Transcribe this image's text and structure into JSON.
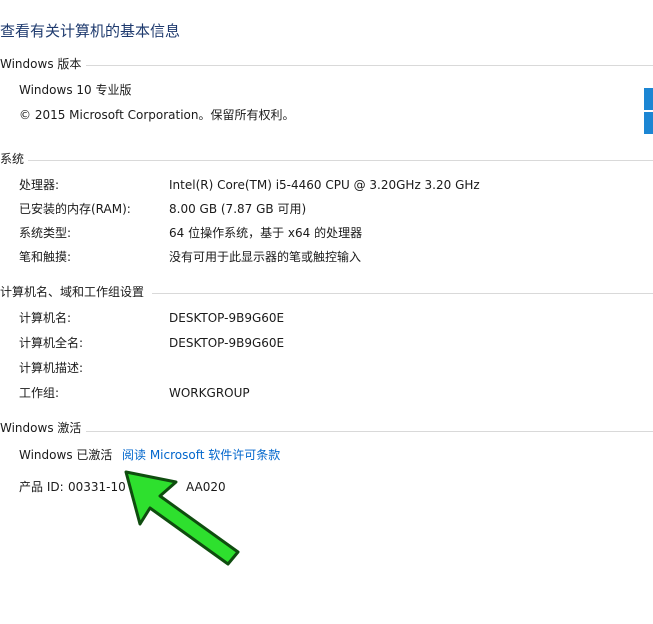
{
  "page": {
    "title": "查看有关计算机的基本信息"
  },
  "edition": {
    "header": "Windows 版本",
    "name": "Windows 10 专业版",
    "copyright": "© 2015 Microsoft Corporation。保留所有权利。"
  },
  "system": {
    "header": "系统",
    "rows": [
      {
        "label": "处理器:",
        "value": "Intel(R) Core(TM) i5-4460  CPU @ 3.20GHz   3.20 GHz"
      },
      {
        "label": "已安装的内存(RAM):",
        "value": "8.00 GB (7.87 GB 可用)"
      },
      {
        "label": "系统类型:",
        "value": "64 位操作系统，基于 x64 的处理器"
      },
      {
        "label": "笔和触摸:",
        "value": "没有可用于此显示器的笔或触控输入"
      }
    ]
  },
  "computer": {
    "header": "计算机名、域和工作组设置",
    "rows": [
      {
        "label": "计算机名:",
        "value": "DESKTOP-9B9G60E"
      },
      {
        "label": "计算机全名:",
        "value": "DESKTOP-9B9G60E"
      },
      {
        "label": "计算机描述:",
        "value": ""
      },
      {
        "label": "工作组:",
        "value": "WORKGROUP"
      }
    ]
  },
  "activation": {
    "header": "Windows 激活",
    "status": "Windows 已激活",
    "license_link": "阅读 Microsoft 软件许可条款",
    "product_id_label": "产品 ID:",
    "product_id_part1": "00331-10",
    "product_id_part2": "AA020"
  },
  "icons": {
    "windows_logo": "windows-logo",
    "arrow": "green-arrow-annotation"
  },
  "colors": {
    "title": "#1e3a6e",
    "link": "#0066cc",
    "logo": "#1c86d3",
    "arrow_fill": "#2ee02e",
    "arrow_stroke": "#0f4d0f"
  }
}
